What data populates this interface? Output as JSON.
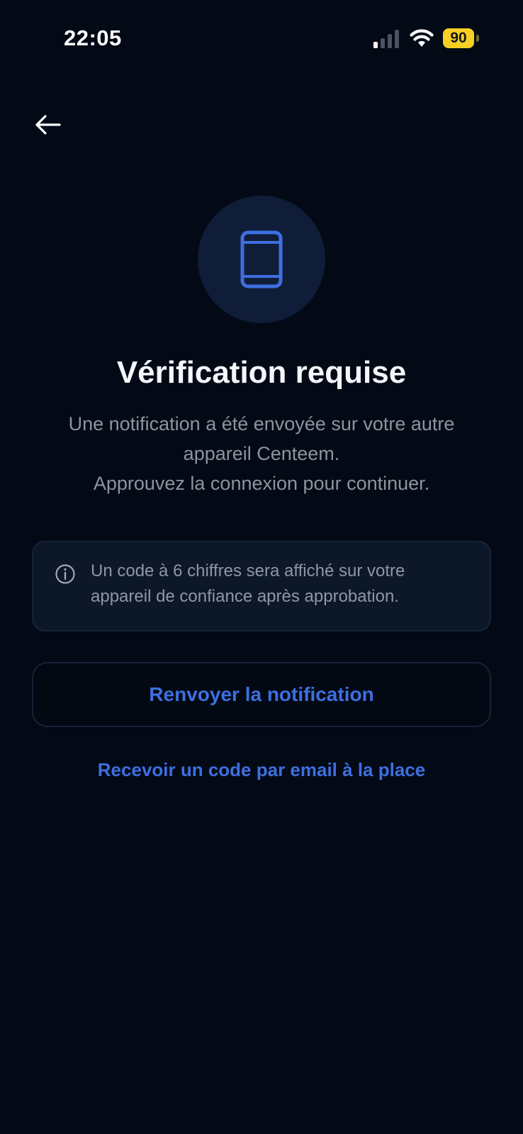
{
  "status_bar": {
    "time": "22:05",
    "battery_level": "90",
    "signal_icon": "cellular-signal-icon",
    "wifi_icon": "wifi-icon",
    "battery_color": "#f6cf23"
  },
  "navigation": {
    "back_icon": "arrow-left-icon"
  },
  "hero": {
    "icon": "smartphone-icon",
    "title": "Vérification requise",
    "description_lines": [
      "Une notification a été envoyée sur votre autre",
      "appareil Centeem.",
      "Approuvez la connexion pour continuer."
    ]
  },
  "info_box": {
    "icon": "info-circle-icon",
    "lines": [
      "Un code à 6 chiffres sera affiché sur votre",
      "appareil de confiance après approbation."
    ]
  },
  "actions": {
    "resend_label": "Renvoyer la notification",
    "email_label": "Recevoir un code par email à la place"
  },
  "colors": {
    "background": "#030a16",
    "accent": "#3d6fe0",
    "icon_circle": "#0f1d38"
  }
}
